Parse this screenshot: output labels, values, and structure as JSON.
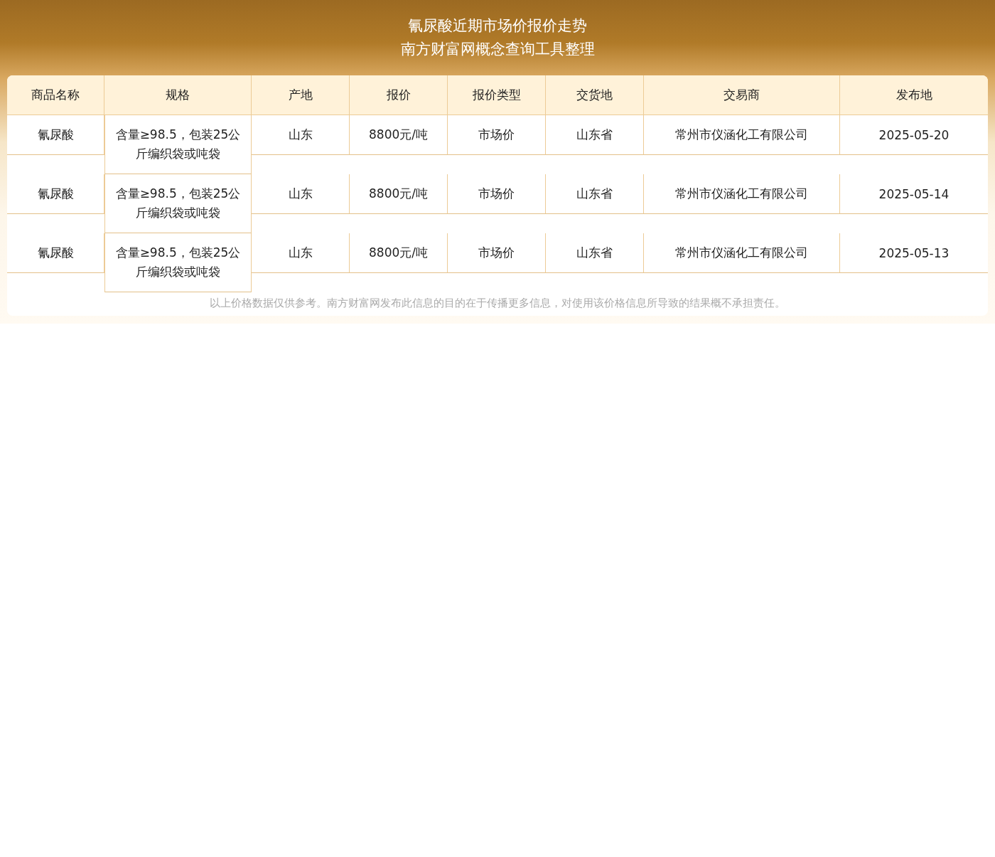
{
  "header": {
    "title": "氰尿酸近期市场价报价走势",
    "subtitle": "南方财富网概念查询工具整理"
  },
  "table": {
    "columns": [
      "商品名称",
      "规格",
      "产地",
      "报价",
      "报价类型",
      "交货地",
      "交易商",
      "发布地"
    ],
    "rows": [
      {
        "cells": [
          "氰尿酸",
          "含量≥98.5，包装25公斤编织袋或吨袋",
          "山东",
          "8800元/吨",
          "市场价",
          "山东省",
          "常州市仪涵化工有限公司",
          "2025-05-20"
        ]
      },
      {
        "cells": [
          "氰尿酸",
          "含量≥98.5，包装25公斤编织袋或吨袋",
          "山东",
          "8800元/吨",
          "市场价",
          "山东省",
          "常州市仪涵化工有限公司",
          "2025-05-14"
        ]
      },
      {
        "cells": [
          "氰尿酸",
          "含量≥98.5，包装25公斤编织袋或吨袋",
          "山东",
          "8800元/吨",
          "市场价",
          "山东省",
          "常州市仪涵化工有限公司",
          "2025-05-13"
        ]
      }
    ]
  },
  "footnote": "以上价格数据仅供参考。南方财富网发布此信息的目的在于传播更多信息，对使用该价格信息所导致的结果概不承担责任。"
}
